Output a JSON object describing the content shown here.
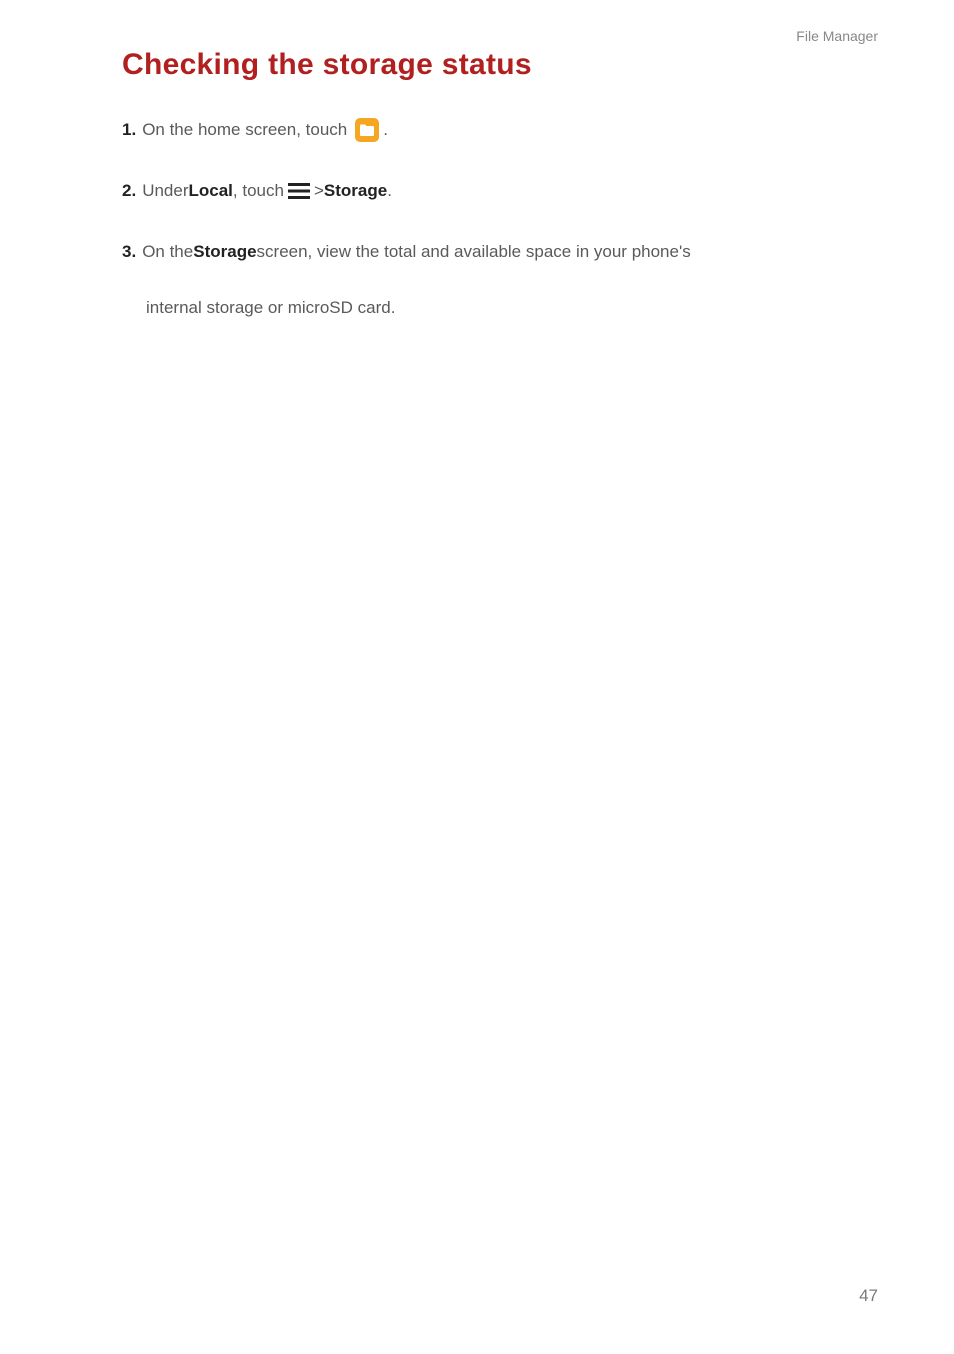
{
  "header": {
    "section_label": "File Manager"
  },
  "title": "Checking the storage status",
  "steps": {
    "s1": {
      "num": "1.",
      "pre": "On the home screen, touch",
      "post": "."
    },
    "s2": {
      "num": "2.",
      "pre": "Under ",
      "local": "Local",
      "mid": ", touch ",
      "gt": " > ",
      "storage": "Storage",
      "post": "."
    },
    "s3": {
      "num": "3.",
      "pre": "On the ",
      "storage": "Storage",
      "tail": " screen, view the total and available space in your phone's",
      "line2": "internal storage or microSD card."
    }
  },
  "page_number": "47"
}
